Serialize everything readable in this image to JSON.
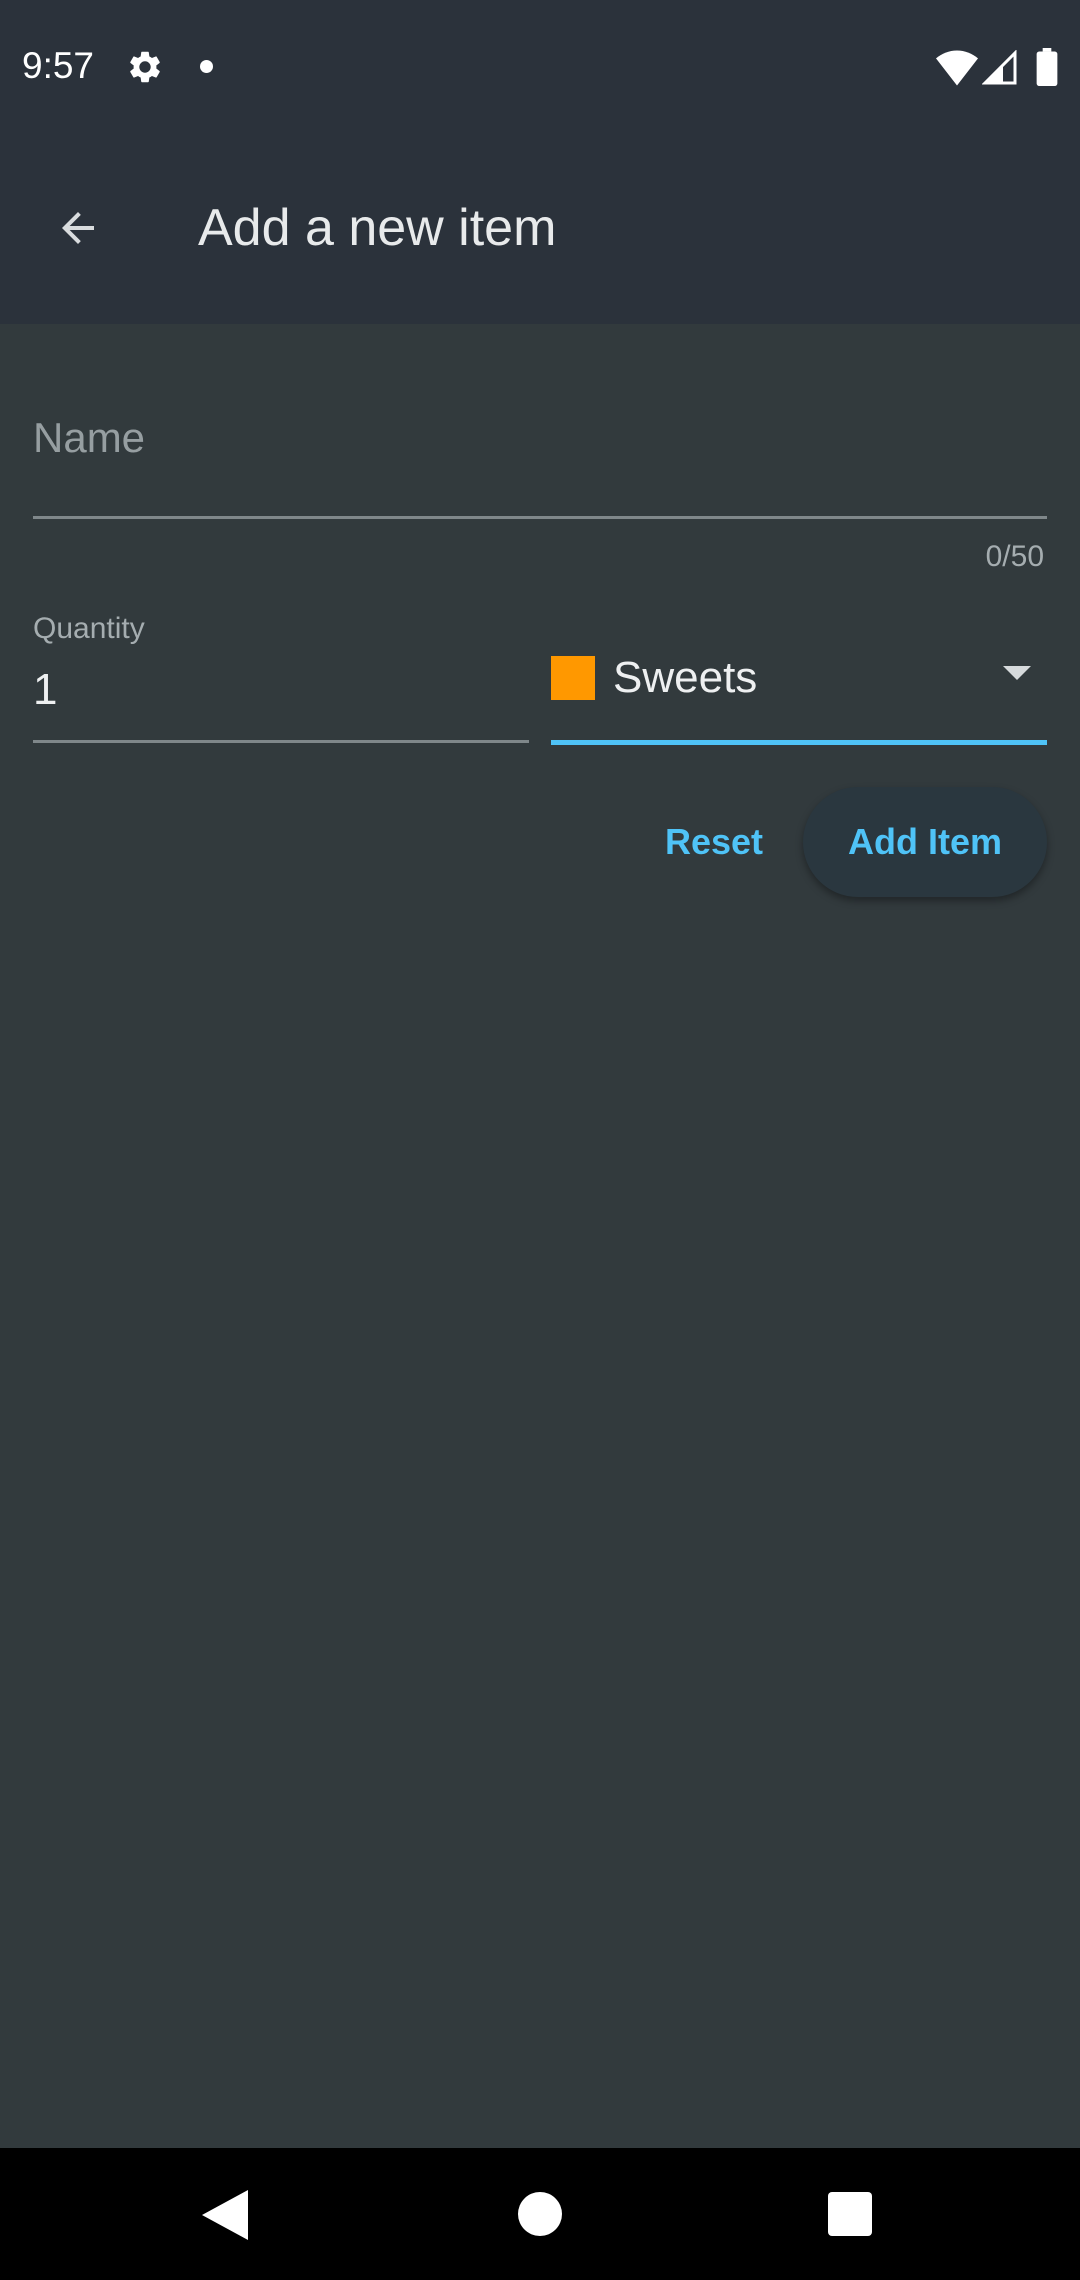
{
  "status_bar": {
    "time": "9:57",
    "icons": [
      "gear-icon",
      "notification-dot-icon",
      "wifi-icon",
      "cell-signal-icon",
      "battery-icon"
    ]
  },
  "app_bar": {
    "back_icon": "arrow-back-icon",
    "title": "Add a new item"
  },
  "form": {
    "name": {
      "placeholder": "Name",
      "value": "",
      "counter": "0/50"
    },
    "quantity": {
      "label": "Quantity",
      "value": "1"
    },
    "category": {
      "value": "Sweets",
      "swatch_color": "#ff9800",
      "dropdown_icon": "dropdown-arrow-icon"
    }
  },
  "actions": {
    "reset_label": "Reset",
    "add_label": "Add Item"
  },
  "nav_bar": {
    "icons": [
      "nav-back-icon",
      "nav-home-icon",
      "nav-recents-icon"
    ]
  },
  "colors": {
    "background": "#323a3d",
    "app_bar": "#2b323b",
    "accent": "#4fc3f7",
    "add_button_bg": "#2a373f"
  }
}
